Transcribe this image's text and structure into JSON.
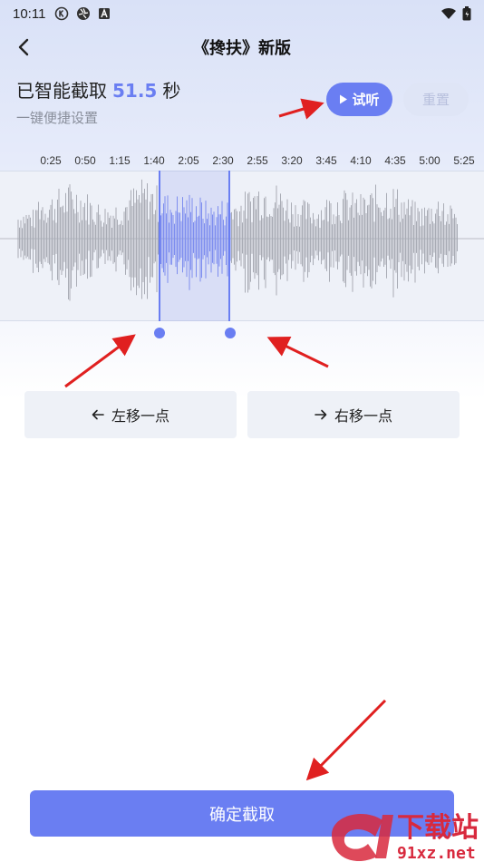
{
  "status_bar": {
    "time": "10:11",
    "icons_left": [
      "k-circle-icon",
      "aperture-icon",
      "a-box-icon"
    ],
    "icons_right": [
      "wifi-icon",
      "battery-icon"
    ]
  },
  "nav": {
    "back_icon": "chevron-left-icon",
    "title": "《搀扶》新版"
  },
  "clip": {
    "prefix": "已智能截取",
    "value": "51.5",
    "unit": "秒",
    "subtitle": "一键便捷设置"
  },
  "buttons": {
    "play_label": "试听",
    "reset_label": "重置",
    "move_left_label": "左移一点",
    "move_right_label": "右移一点",
    "confirm_label": "确定截取"
  },
  "timeline": {
    "ticks": [
      "0:25",
      "0:50",
      "1:15",
      "1:40",
      "2:05",
      "2:30",
      "2:55",
      "3:20",
      "3:45",
      "4:10",
      "4:35",
      "5:00",
      "5:25"
    ]
  },
  "colors": {
    "accent": "#6a7ef2",
    "waveform": "#a9acb5",
    "selected_waveform": "#7f8ff0",
    "annotation_arrow": "#e02020"
  },
  "watermark": {
    "text_top": "下载站",
    "text_bottom": "91xz.net"
  }
}
